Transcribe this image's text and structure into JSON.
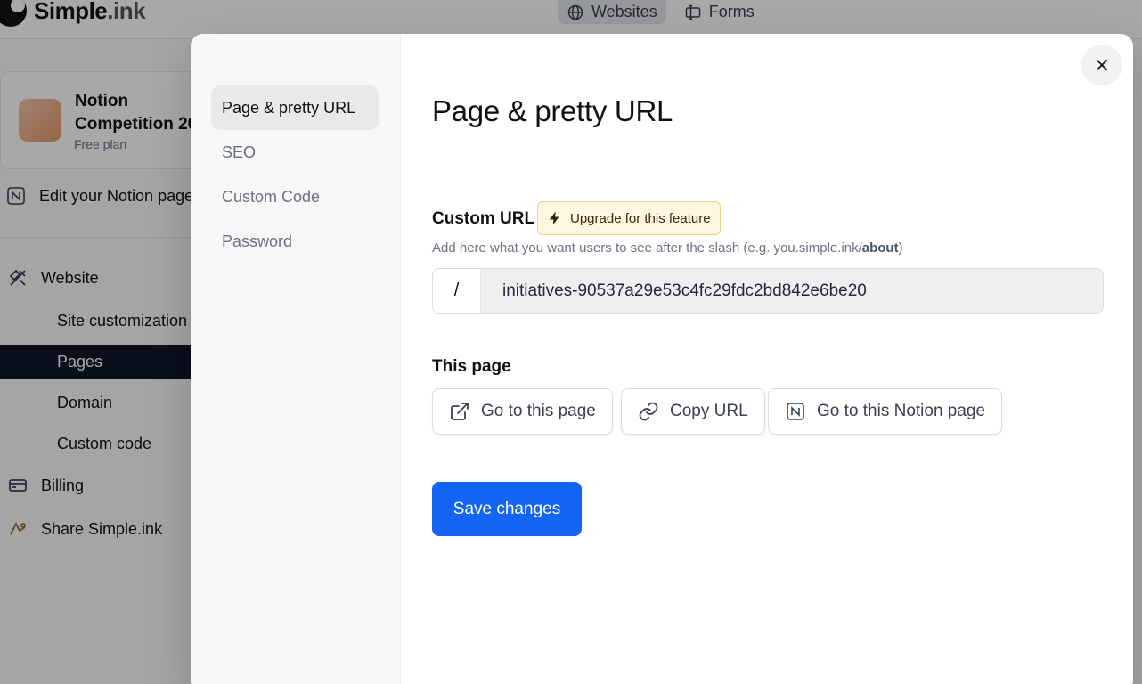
{
  "app": {
    "brand": {
      "name_main": "Simple",
      "name_suffix": ".ink"
    },
    "topnav": [
      {
        "label": "Websites",
        "icon": "globe-icon",
        "active": true
      },
      {
        "label": "Forms",
        "icon": "form-icon",
        "active": false
      }
    ],
    "project": {
      "name": "Notion\nCompetition 20",
      "plan": "Free plan"
    },
    "sidebar": {
      "edit_notion": "Edit your Notion page",
      "website": "Website",
      "sub_items": [
        "Site customization",
        "Pages",
        "Domain",
        "Custom code"
      ],
      "active_sub": "Pages",
      "billing": "Billing",
      "share": "Share Simple.ink"
    }
  },
  "modal": {
    "nav": [
      "Page & pretty URL",
      "SEO",
      "Custom Code",
      "Password"
    ],
    "active_nav": "Page & pretty URL",
    "title": "Page & pretty URL",
    "custom_url": {
      "label": "Custom URL",
      "upgrade_badge": "Upgrade for this feature",
      "help_prefix": "Add here what you want users to see after the slash (e.g. you.simple.ink/",
      "help_bold": "about",
      "help_suffix": ")",
      "prefix": "/",
      "value": "initiatives-90537a29e53c4fc29fdc2bd842e6be20"
    },
    "this_page": {
      "label": "This page",
      "go_to_page": "Go to this page",
      "copy_url": "Copy URL",
      "go_to_notion": "Go to this Notion page"
    },
    "save_label": "Save changes"
  },
  "colors": {
    "primary": "#1464f6",
    "upgrade_bg": "#fdf6e0",
    "upgrade_border": "#f2d27a",
    "active_sidebar": "#0f172a"
  }
}
